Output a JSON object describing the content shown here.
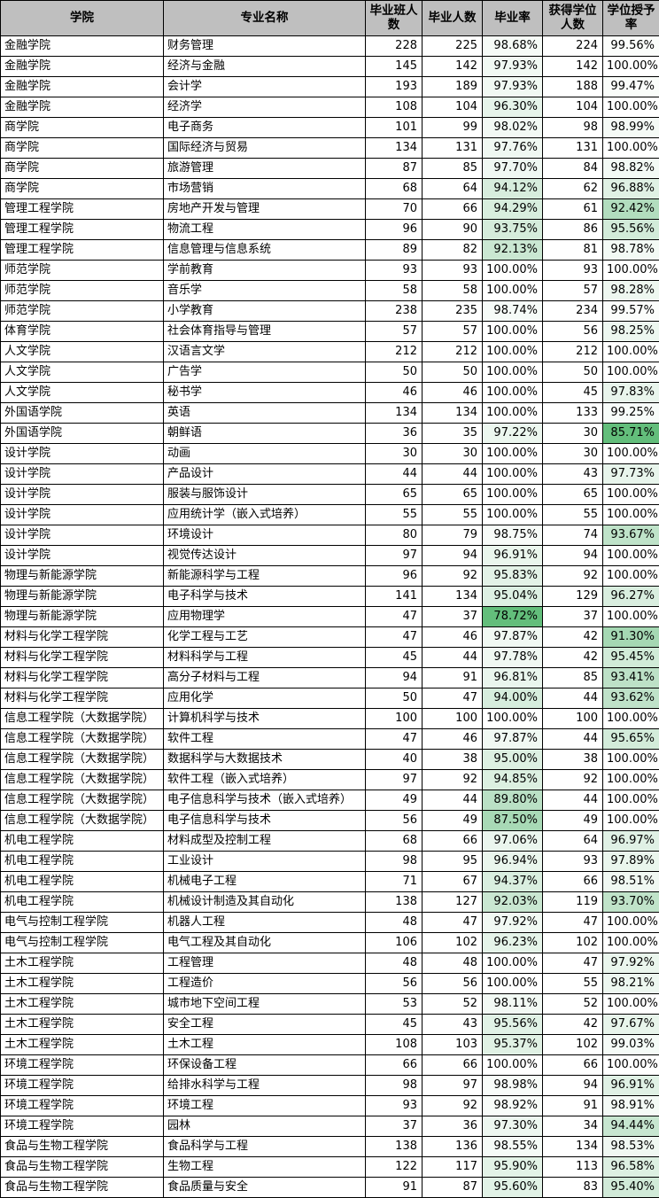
{
  "table": {
    "columns": [
      {
        "key": "college",
        "label": "学院",
        "align": "center"
      },
      {
        "key": "major",
        "label": "专业名称",
        "align": "center"
      },
      {
        "key": "classnum",
        "label": "毕业班人数",
        "align": "center"
      },
      {
        "key": "gradnum",
        "label": "毕业人数",
        "align": "center"
      },
      {
        "key": "gradrate",
        "label": "毕业率",
        "align": "center"
      },
      {
        "key": "degnum",
        "label": "获得学位人数",
        "align": "center"
      },
      {
        "key": "degrate",
        "label": "学位授予率",
        "align": "center"
      }
    ],
    "header_bg": "#bfbfbf",
    "border_color": "#000000",
    "gradient": {
      "type": "3-color-scale",
      "min_color": "#63be7b",
      "mid_color": "#b7dfc2",
      "max_color": "#ffffff",
      "applies_to": [
        "gradrate",
        "degrate"
      ],
      "gradrate_min": 78.72,
      "gradrate_max": 100.0,
      "degrate_min": 85.71,
      "degrate_max": 100.0
    },
    "rows": [
      {
        "college": "金融学院",
        "major": "财务管理",
        "classnum": "228",
        "gradnum": "225",
        "gradrate": "98.68%",
        "degnum": "224",
        "degrate": "99.56%",
        "gradrate_v": 98.68,
        "degrate_v": 99.56
      },
      {
        "college": "金融学院",
        "major": "经济与金融",
        "classnum": "145",
        "gradnum": "142",
        "gradrate": "97.93%",
        "degnum": "142",
        "degrate": "100.00%",
        "gradrate_v": 97.93,
        "degrate_v": 100.0
      },
      {
        "college": "金融学院",
        "major": "会计学",
        "classnum": "193",
        "gradnum": "189",
        "gradrate": "97.93%",
        "degnum": "188",
        "degrate": "99.47%",
        "gradrate_v": 97.93,
        "degrate_v": 99.47
      },
      {
        "college": "金融学院",
        "major": "经济学",
        "classnum": "108",
        "gradnum": "104",
        "gradrate": "96.30%",
        "degnum": "104",
        "degrate": "100.00%",
        "gradrate_v": 96.3,
        "degrate_v": 100.0
      },
      {
        "college": "商学院",
        "major": "电子商务",
        "classnum": "101",
        "gradnum": "99",
        "gradrate": "98.02%",
        "degnum": "98",
        "degrate": "98.99%",
        "gradrate_v": 98.02,
        "degrate_v": 98.99
      },
      {
        "college": "商学院",
        "major": "国际经济与贸易",
        "classnum": "134",
        "gradnum": "131",
        "gradrate": "97.76%",
        "degnum": "131",
        "degrate": "100.00%",
        "gradrate_v": 97.76,
        "degrate_v": 100.0
      },
      {
        "college": "商学院",
        "major": "旅游管理",
        "classnum": "87",
        "gradnum": "85",
        "gradrate": "97.70%",
        "degnum": "84",
        "degrate": "98.82%",
        "gradrate_v": 97.7,
        "degrate_v": 98.82
      },
      {
        "college": "商学院",
        "major": "市场营销",
        "classnum": "68",
        "gradnum": "64",
        "gradrate": "94.12%",
        "degnum": "62",
        "degrate": "96.88%",
        "gradrate_v": 94.12,
        "degrate_v": 96.88
      },
      {
        "college": "管理工程学院",
        "major": "房地产开发与管理",
        "classnum": "70",
        "gradnum": "66",
        "gradrate": "94.29%",
        "degnum": "61",
        "degrate": "92.42%",
        "gradrate_v": 94.29,
        "degrate_v": 92.42
      },
      {
        "college": "管理工程学院",
        "major": "物流工程",
        "classnum": "96",
        "gradnum": "90",
        "gradrate": "93.75%",
        "degnum": "86",
        "degrate": "95.56%",
        "gradrate_v": 93.75,
        "degrate_v": 95.56
      },
      {
        "college": "管理工程学院",
        "major": "信息管理与信息系统",
        "classnum": "89",
        "gradnum": "82",
        "gradrate": "92.13%",
        "degnum": "81",
        "degrate": "98.78%",
        "gradrate_v": 92.13,
        "degrate_v": 98.78
      },
      {
        "college": "师范学院",
        "major": "学前教育",
        "classnum": "93",
        "gradnum": "93",
        "gradrate": "100.00%",
        "degnum": "93",
        "degrate": "100.00%",
        "gradrate_v": 100.0,
        "degrate_v": 100.0
      },
      {
        "college": "师范学院",
        "major": "音乐学",
        "classnum": "58",
        "gradnum": "58",
        "gradrate": "100.00%",
        "degnum": "57",
        "degrate": "98.28%",
        "gradrate_v": 100.0,
        "degrate_v": 98.28
      },
      {
        "college": "师范学院",
        "major": "小学教育",
        "classnum": "238",
        "gradnum": "235",
        "gradrate": "98.74%",
        "degnum": "234",
        "degrate": "99.57%",
        "gradrate_v": 98.74,
        "degrate_v": 99.57
      },
      {
        "college": "体育学院",
        "major": "社会体育指导与管理",
        "classnum": "57",
        "gradnum": "57",
        "gradrate": "100.00%",
        "degnum": "56",
        "degrate": "98.25%",
        "gradrate_v": 100.0,
        "degrate_v": 98.25
      },
      {
        "college": "人文学院",
        "major": "汉语言文学",
        "classnum": "212",
        "gradnum": "212",
        "gradrate": "100.00%",
        "degnum": "212",
        "degrate": "100.00%",
        "gradrate_v": 100.0,
        "degrate_v": 100.0
      },
      {
        "college": "人文学院",
        "major": "广告学",
        "classnum": "50",
        "gradnum": "50",
        "gradrate": "100.00%",
        "degnum": "50",
        "degrate": "100.00%",
        "gradrate_v": 100.0,
        "degrate_v": 100.0
      },
      {
        "college": "人文学院",
        "major": "秘书学",
        "classnum": "46",
        "gradnum": "46",
        "gradrate": "100.00%",
        "degnum": "45",
        "degrate": "97.83%",
        "gradrate_v": 100.0,
        "degrate_v": 97.83
      },
      {
        "college": "外国语学院",
        "major": "英语",
        "classnum": "134",
        "gradnum": "134",
        "gradrate": "100.00%",
        "degnum": "133",
        "degrate": "99.25%",
        "gradrate_v": 100.0,
        "degrate_v": 99.25
      },
      {
        "college": "外国语学院",
        "major": "朝鲜语",
        "classnum": "36",
        "gradnum": "35",
        "gradrate": "97.22%",
        "degnum": "30",
        "degrate": "85.71%",
        "gradrate_v": 97.22,
        "degrate_v": 85.71
      },
      {
        "college": "设计学院",
        "major": "动画",
        "classnum": "30",
        "gradnum": "30",
        "gradrate": "100.00%",
        "degnum": "30",
        "degrate": "100.00%",
        "gradrate_v": 100.0,
        "degrate_v": 100.0
      },
      {
        "college": "设计学院",
        "major": "产品设计",
        "classnum": "44",
        "gradnum": "44",
        "gradrate": "100.00%",
        "degnum": "43",
        "degrate": "97.73%",
        "gradrate_v": 100.0,
        "degrate_v": 97.73
      },
      {
        "college": "设计学院",
        "major": "服装与服饰设计",
        "classnum": "65",
        "gradnum": "65",
        "gradrate": "100.00%",
        "degnum": "65",
        "degrate": "100.00%",
        "gradrate_v": 100.0,
        "degrate_v": 100.0
      },
      {
        "college": "设计学院",
        "major": "应用统计学（嵌入式培养）",
        "classnum": "55",
        "gradnum": "55",
        "gradrate": "100.00%",
        "degnum": "55",
        "degrate": "100.00%",
        "gradrate_v": 100.0,
        "degrate_v": 100.0
      },
      {
        "college": "设计学院",
        "major": "环境设计",
        "classnum": "80",
        "gradnum": "79",
        "gradrate": "98.75%",
        "degnum": "74",
        "degrate": "93.67%",
        "gradrate_v": 98.75,
        "degrate_v": 93.67
      },
      {
        "college": "设计学院",
        "major": "视觉传达设计",
        "classnum": "97",
        "gradnum": "94",
        "gradrate": "96.91%",
        "degnum": "94",
        "degrate": "100.00%",
        "gradrate_v": 96.91,
        "degrate_v": 100.0
      },
      {
        "college": "物理与新能源学院",
        "major": "新能源科学与工程",
        "classnum": "96",
        "gradnum": "92",
        "gradrate": "95.83%",
        "degnum": "92",
        "degrate": "100.00%",
        "gradrate_v": 95.83,
        "degrate_v": 100.0
      },
      {
        "college": "物理与新能源学院",
        "major": "电子科学与技术",
        "classnum": "141",
        "gradnum": "134",
        "gradrate": "95.04%",
        "degnum": "129",
        "degrate": "96.27%",
        "gradrate_v": 95.04,
        "degrate_v": 96.27
      },
      {
        "college": "物理与新能源学院",
        "major": "应用物理学",
        "classnum": "47",
        "gradnum": "37",
        "gradrate": "78.72%",
        "degnum": "37",
        "degrate": "100.00%",
        "gradrate_v": 78.72,
        "degrate_v": 100.0
      },
      {
        "college": "材料与化学工程学院",
        "major": "化学工程与工艺",
        "classnum": "47",
        "gradnum": "46",
        "gradrate": "97.87%",
        "degnum": "42",
        "degrate": "91.30%",
        "gradrate_v": 97.87,
        "degrate_v": 91.3
      },
      {
        "college": "材料与化学工程学院",
        "major": "材料科学与工程",
        "classnum": "45",
        "gradnum": "44",
        "gradrate": "97.78%",
        "degnum": "42",
        "degrate": "95.45%",
        "gradrate_v": 97.78,
        "degrate_v": 95.45
      },
      {
        "college": "材料与化学工程学院",
        "major": "高分子材料与工程",
        "classnum": "94",
        "gradnum": "91",
        "gradrate": "96.81%",
        "degnum": "85",
        "degrate": "93.41%",
        "gradrate_v": 96.81,
        "degrate_v": 93.41
      },
      {
        "college": "材料与化学工程学院",
        "major": "应用化学",
        "classnum": "50",
        "gradnum": "47",
        "gradrate": "94.00%",
        "degnum": "44",
        "degrate": "93.62%",
        "gradrate_v": 94.0,
        "degrate_v": 93.62
      },
      {
        "college": "信息工程学院（大数据学院）",
        "major": "计算机科学与技术",
        "classnum": "100",
        "gradnum": "100",
        "gradrate": "100.00%",
        "degnum": "100",
        "degrate": "100.00%",
        "gradrate_v": 100.0,
        "degrate_v": 100.0
      },
      {
        "college": "信息工程学院（大数据学院）",
        "major": "软件工程",
        "classnum": "47",
        "gradnum": "46",
        "gradrate": "97.87%",
        "degnum": "44",
        "degrate": "95.65%",
        "gradrate_v": 97.87,
        "degrate_v": 95.65
      },
      {
        "college": "信息工程学院（大数据学院）",
        "major": "数据科学与大数据技术",
        "classnum": "40",
        "gradnum": "38",
        "gradrate": "95.00%",
        "degnum": "38",
        "degrate": "100.00%",
        "gradrate_v": 95.0,
        "degrate_v": 100.0
      },
      {
        "college": "信息工程学院（大数据学院）",
        "major": "软件工程（嵌入式培养）",
        "classnum": "97",
        "gradnum": "92",
        "gradrate": "94.85%",
        "degnum": "92",
        "degrate": "100.00%",
        "gradrate_v": 94.85,
        "degrate_v": 100.0
      },
      {
        "college": "信息工程学院（大数据学院）",
        "major": "电子信息科学与技术（嵌入式培养）",
        "classnum": "49",
        "gradnum": "44",
        "gradrate": "89.80%",
        "degnum": "44",
        "degrate": "100.00%",
        "gradrate_v": 89.8,
        "degrate_v": 100.0
      },
      {
        "college": "信息工程学院（大数据学院）",
        "major": "电子信息科学与技术",
        "classnum": "56",
        "gradnum": "49",
        "gradrate": "87.50%",
        "degnum": "49",
        "degrate": "100.00%",
        "gradrate_v": 87.5,
        "degrate_v": 100.0
      },
      {
        "college": "机电工程学院",
        "major": "材料成型及控制工程",
        "classnum": "68",
        "gradnum": "66",
        "gradrate": "97.06%",
        "degnum": "64",
        "degrate": "96.97%",
        "gradrate_v": 97.06,
        "degrate_v": 96.97
      },
      {
        "college": "机电工程学院",
        "major": "工业设计",
        "classnum": "98",
        "gradnum": "95",
        "gradrate": "96.94%",
        "degnum": "93",
        "degrate": "97.89%",
        "gradrate_v": 96.94,
        "degrate_v": 97.89
      },
      {
        "college": "机电工程学院",
        "major": "机械电子工程",
        "classnum": "71",
        "gradnum": "67",
        "gradrate": "94.37%",
        "degnum": "66",
        "degrate": "98.51%",
        "gradrate_v": 94.37,
        "degrate_v": 98.51
      },
      {
        "college": "机电工程学院",
        "major": "机械设计制造及其自动化",
        "classnum": "138",
        "gradnum": "127",
        "gradrate": "92.03%",
        "degnum": "119",
        "degrate": "93.70%",
        "gradrate_v": 92.03,
        "degrate_v": 93.7
      },
      {
        "college": "电气与控制工程学院",
        "major": "机器人工程",
        "classnum": "48",
        "gradnum": "47",
        "gradrate": "97.92%",
        "degnum": "47",
        "degrate": "100.00%",
        "gradrate_v": 97.92,
        "degrate_v": 100.0
      },
      {
        "college": "电气与控制工程学院",
        "major": "电气工程及其自动化",
        "classnum": "106",
        "gradnum": "102",
        "gradrate": "96.23%",
        "degnum": "102",
        "degrate": "100.00%",
        "gradrate_v": 96.23,
        "degrate_v": 100.0
      },
      {
        "college": "土木工程学院",
        "major": "工程管理",
        "classnum": "48",
        "gradnum": "48",
        "gradrate": "100.00%",
        "degnum": "47",
        "degrate": "97.92%",
        "gradrate_v": 100.0,
        "degrate_v": 97.92
      },
      {
        "college": "土木工程学院",
        "major": "工程造价",
        "classnum": "56",
        "gradnum": "56",
        "gradrate": "100.00%",
        "degnum": "55",
        "degrate": "98.21%",
        "gradrate_v": 100.0,
        "degrate_v": 98.21
      },
      {
        "college": "土木工程学院",
        "major": "城市地下空间工程",
        "classnum": "53",
        "gradnum": "52",
        "gradrate": "98.11%",
        "degnum": "52",
        "degrate": "100.00%",
        "gradrate_v": 98.11,
        "degrate_v": 100.0
      },
      {
        "college": "土木工程学院",
        "major": "安全工程",
        "classnum": "45",
        "gradnum": "43",
        "gradrate": "95.56%",
        "degnum": "42",
        "degrate": "97.67%",
        "gradrate_v": 95.56,
        "degrate_v": 97.67
      },
      {
        "college": "土木工程学院",
        "major": "土木工程",
        "classnum": "108",
        "gradnum": "103",
        "gradrate": "95.37%",
        "degnum": "102",
        "degrate": "99.03%",
        "gradrate_v": 95.37,
        "degrate_v": 99.03
      },
      {
        "college": "环境工程学院",
        "major": "环保设备工程",
        "classnum": "66",
        "gradnum": "66",
        "gradrate": "100.00%",
        "degnum": "66",
        "degrate": "100.00%",
        "gradrate_v": 100.0,
        "degrate_v": 100.0
      },
      {
        "college": "环境工程学院",
        "major": "给排水科学与工程",
        "classnum": "98",
        "gradnum": "97",
        "gradrate": "98.98%",
        "degnum": "94",
        "degrate": "96.91%",
        "gradrate_v": 98.98,
        "degrate_v": 96.91
      },
      {
        "college": "环境工程学院",
        "major": "环境工程",
        "classnum": "93",
        "gradnum": "92",
        "gradrate": "98.92%",
        "degnum": "91",
        "degrate": "98.91%",
        "gradrate_v": 98.92,
        "degrate_v": 98.91
      },
      {
        "college": "环境工程学院",
        "major": "园林",
        "classnum": "37",
        "gradnum": "36",
        "gradrate": "97.30%",
        "degnum": "34",
        "degrate": "94.44%",
        "gradrate_v": 97.3,
        "degrate_v": 94.44
      },
      {
        "college": "食品与生物工程学院",
        "major": "食品科学与工程",
        "classnum": "138",
        "gradnum": "136",
        "gradrate": "98.55%",
        "degnum": "134",
        "degrate": "98.53%",
        "gradrate_v": 98.55,
        "degrate_v": 98.53
      },
      {
        "college": "食品与生物工程学院",
        "major": "生物工程",
        "classnum": "122",
        "gradnum": "117",
        "gradrate": "95.90%",
        "degnum": "113",
        "degrate": "96.58%",
        "gradrate_v": 95.9,
        "degrate_v": 96.58
      },
      {
        "college": "食品与生物工程学院",
        "major": "食品质量与安全",
        "classnum": "91",
        "gradnum": "87",
        "gradrate": "95.60%",
        "degnum": "83",
        "degrate": "95.40%",
        "gradrate_v": 95.6,
        "degrate_v": 95.4
      }
    ]
  }
}
